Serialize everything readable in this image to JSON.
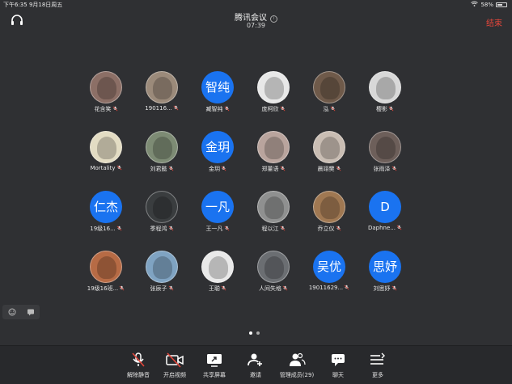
{
  "status_bar": {
    "time_date": "下午6:35  9月18日周五",
    "battery": "58%",
    "battery_level": 0.58
  },
  "meeting": {
    "title": "腾讯会议",
    "duration": "07:39",
    "end_label": "结束"
  },
  "participants": [
    {
      "name": "花含笑",
      "avatar_text": "",
      "avatar_color": "#8c6f66"
    },
    {
      "name": "190116...",
      "avatar_text": "",
      "avatar_color": "#9b8a7a"
    },
    {
      "name": "臧智纯",
      "avatar_text": "智纯",
      "avatar_color": "#1a73f0"
    },
    {
      "name": "庞柯欣",
      "avatar_text": "",
      "avatar_color": "#e8e8e8"
    },
    {
      "name": "泓",
      "avatar_text": "",
      "avatar_color": "#6f5a4a"
    },
    {
      "name": "樱影",
      "avatar_text": "",
      "avatar_color": "#d8d8d8"
    },
    {
      "name": "Mortality",
      "avatar_text": "",
      "avatar_color": "#e3dcc3"
    },
    {
      "name": "刘君懿",
      "avatar_text": "",
      "avatar_color": "#7d8b74"
    },
    {
      "name": "金玥",
      "avatar_text": "金玥",
      "avatar_color": "#1a73f0"
    },
    {
      "name": "郑董语",
      "avatar_text": "",
      "avatar_color": "#b9a49d"
    },
    {
      "name": "晨翊樊",
      "avatar_text": "",
      "avatar_color": "#c9bdb3"
    },
    {
      "name": "张雨泽",
      "avatar_text": "",
      "avatar_color": "#6d5f5a"
    },
    {
      "name": "19级16...",
      "avatar_text": "仁杰",
      "avatar_color": "#1a73f0"
    },
    {
      "name": "季程鸿",
      "avatar_text": "",
      "avatar_color": "#3a3d3f"
    },
    {
      "name": "王一凡",
      "avatar_text": "一凡",
      "avatar_color": "#1a73f0"
    },
    {
      "name": "程以江",
      "avatar_text": "",
      "avatar_color": "#8f9090"
    },
    {
      "name": "乔立仪",
      "avatar_text": "",
      "avatar_color": "#a07852"
    },
    {
      "name": "Daphne...",
      "avatar_text": "D",
      "avatar_color": "#1a73f0"
    },
    {
      "name": "19级16班...",
      "avatar_text": "",
      "avatar_color": "#b76b45"
    },
    {
      "name": "张辰子",
      "avatar_text": "",
      "avatar_color": "#7fa3c2"
    },
    {
      "name": "王聪",
      "avatar_text": "",
      "avatar_color": "#e9e9e9"
    },
    {
      "name": "人间失格",
      "avatar_text": "",
      "avatar_color": "#6b6e72"
    },
    {
      "name": "19011629...",
      "avatar_text": "吴优",
      "avatar_color": "#1a73f0"
    },
    {
      "name": "刘思妤",
      "avatar_text": "思妤",
      "avatar_color": "#1a73f0"
    }
  ],
  "toolbar": [
    {
      "label": "解除静音",
      "icon": "mic-muted-icon"
    },
    {
      "label": "开启视频",
      "icon": "video-off-icon"
    },
    {
      "label": "共享屏幕",
      "icon": "share-screen-icon"
    },
    {
      "label": "邀请",
      "icon": "invite-icon"
    },
    {
      "label": "管理成员(29)",
      "icon": "members-icon"
    },
    {
      "label": "聊天",
      "icon": "chat-icon"
    },
    {
      "label": "更多",
      "icon": "more-icon"
    }
  ],
  "pagination": {
    "pages": 2,
    "current": 1
  },
  "colors": {
    "background": "#2f3033",
    "accent": "#1a73f0",
    "end": "#e5463b",
    "toolbar": "#28292c"
  }
}
